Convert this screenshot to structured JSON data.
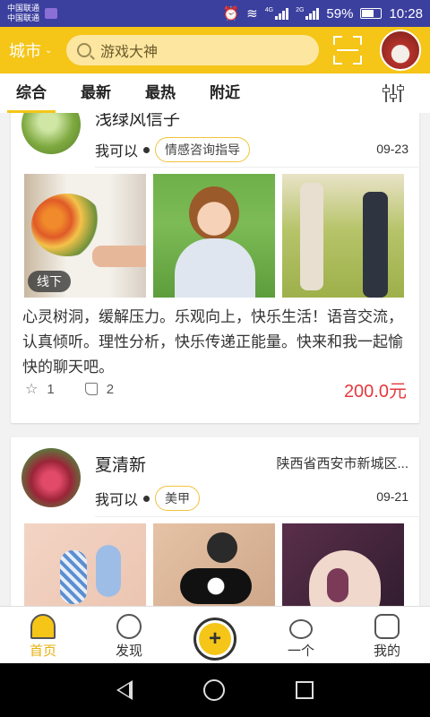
{
  "status_bar": {
    "carrier_1": "中国联通",
    "carrier_2": "中国联通",
    "network_1": "4G",
    "network_2": "2G",
    "battery": "59%",
    "time": "10:28"
  },
  "header": {
    "city_label": "城市",
    "search_placeholder": "游戏大神",
    "accent_color": "#f5c518"
  },
  "tabs": [
    {
      "label": "综合",
      "active": true
    },
    {
      "label": "最新"
    },
    {
      "label": "最热"
    },
    {
      "label": "附近"
    }
  ],
  "posts": [
    {
      "name": "浅绿风信子",
      "status": "我可以",
      "tag": "情感咨询指导",
      "date": "09-23",
      "badge": "线下",
      "description": "心灵树洞，缓解压力。乐观向上，快乐生活！语音交流，认真倾听。理性分析，快乐传递正能量。快来和我一起愉快的聊天吧。",
      "stars": "1",
      "likes": "2",
      "price": "200.0元"
    },
    {
      "name": "夏清新",
      "location": "陕西省西安市新城区...",
      "status": "我可以",
      "tag": "美甲",
      "date": "09-21"
    }
  ],
  "bottom_nav": [
    {
      "label": "首页",
      "icon": "home-icon",
      "active": true
    },
    {
      "label": "发现",
      "icon": "discover-icon"
    },
    {
      "label": "",
      "icon": "add-icon"
    },
    {
      "label": "一个",
      "icon": "share-icon"
    },
    {
      "label": "我的",
      "icon": "profile-icon"
    }
  ],
  "colors": {
    "status_bar": "#3b3f9e",
    "price": "#e4393c",
    "active_nav": "#e8b00c"
  }
}
